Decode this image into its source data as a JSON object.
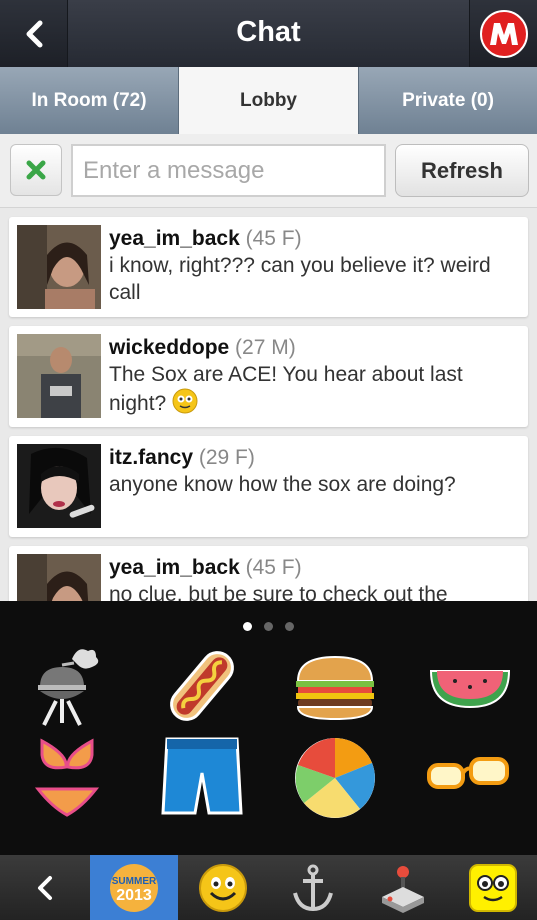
{
  "header": {
    "title": "Chat",
    "back_icon": "chevron-left-icon",
    "logo_icon": "brand-m-logo-icon"
  },
  "tabs": [
    {
      "label": "In Room (72)"
    },
    {
      "label": "Lobby"
    },
    {
      "label": "Private (0)"
    }
  ],
  "input_bar": {
    "placeholder": "Enter a message",
    "value": "",
    "refresh_label": "Refresh",
    "clear_icon": "close-x-icon"
  },
  "messages": [
    {
      "username": "yea_im_back",
      "meta": "(45 F)",
      "text": "i know, right??? can you believe it? weird call"
    },
    {
      "username": "wickeddope",
      "meta": "(27 M)",
      "text": "The Sox are ACE! You hear about last night?"
    },
    {
      "username": "itz.fancy",
      "meta": "(29 F)",
      "text": "anyone know how the sox are doing?"
    },
    {
      "username": "yea_im_back",
      "meta": "(45 F)",
      "text": "no clue, but be sure to check out the"
    }
  ],
  "stickers": {
    "page_dots": 3,
    "active_dot": 1,
    "items": [
      "grill-icon",
      "hot-dog-icon",
      "burger-icon",
      "watermelon-icon",
      "bikini-icon",
      "swim-shorts-icon",
      "beach-ball-icon",
      "sunglasses-icon"
    ]
  },
  "tray": {
    "items": [
      "chevron-left-icon",
      "summer-2013-icon",
      "smiley-icon",
      "anchor-icon",
      "joystick-icon",
      "yellow-face-icon"
    ],
    "summer_line1": "SUMMER",
    "summer_line2": "2013",
    "selected": 1
  },
  "colors": {
    "tab_inactive": "#8a9aaa",
    "header": "#2e323b",
    "selected_tray": "#3c7fd4",
    "clear_green": "#3aa647"
  }
}
